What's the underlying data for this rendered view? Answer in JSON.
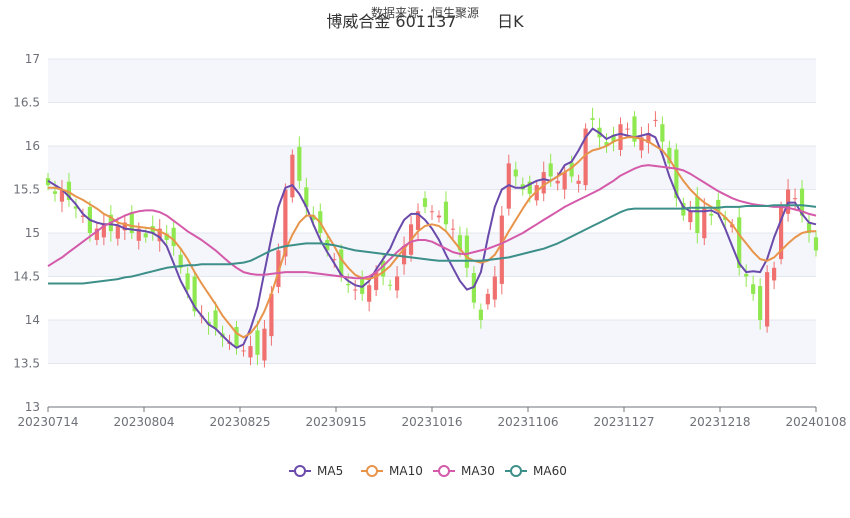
{
  "chart_data": {
    "type": "candlestick",
    "title": "博威合金 601137        日K",
    "subtitle": "数据来源：恒生聚源",
    "ylim": [
      13,
      17
    ],
    "y_ticks": [
      13,
      13.5,
      14,
      14.5,
      15,
      15.5,
      16,
      16.5,
      17
    ],
    "x_tick_labels": [
      "20230714",
      "20230804",
      "20230825",
      "20230915",
      "20231016",
      "20231106",
      "20231127",
      "20231218",
      "20240108"
    ],
    "grid": true,
    "legend_position": "bottom-center",
    "up_color": "#f07070",
    "down_color": "#90e850",
    "close": [
      15.55,
      15.45,
      15.5,
      15.38,
      15.28,
      15.2,
      15.0,
      15.05,
      15.1,
      15.02,
      15.08,
      15.12,
      15.0,
      15.05,
      14.95,
      15.0,
      15.05,
      14.92,
      14.85,
      14.6,
      14.35,
      14.1,
      14.05,
      13.95,
      13.9,
      13.8,
      13.75,
      13.7,
      13.65,
      13.7,
      13.6,
      13.9,
      14.3,
      14.8,
      15.5,
      15.9,
      15.6,
      15.3,
      15.15,
      15.0,
      14.8,
      14.7,
      14.5,
      14.4,
      14.35,
      14.3,
      14.4,
      14.55,
      14.5,
      14.4,
      14.5,
      14.85,
      15.1,
      15.25,
      15.3,
      15.25,
      15.2,
      15.1,
      15.05,
      14.8,
      14.6,
      14.2,
      14.0,
      14.3,
      14.5,
      15.2,
      15.8,
      15.65,
      15.5,
      15.45,
      15.55,
      15.7,
      15.65,
      15.6,
      15.7,
      15.65,
      15.6,
      16.2,
      16.3,
      16.1,
      16.0,
      16.05,
      16.25,
      16.2,
      16.05,
      16.1,
      16.15,
      16.3,
      16.05,
      15.8,
      15.4,
      15.2,
      15.25,
      15.0,
      15.3,
      15.2,
      15.25,
      15.15,
      15.1,
      14.6,
      14.5,
      14.3,
      14.0,
      14.55,
      14.6,
      15.3,
      15.5,
      15.4,
      15.2,
      15.0,
      14.8
    ],
    "series": [
      {
        "name": "MA5",
        "color": "#6a4aab",
        "values": [
          15.6,
          15.55,
          15.5,
          15.42,
          15.33,
          15.22,
          15.15,
          15.12,
          15.1,
          15.1,
          15.09,
          15.05,
          15.04,
          15.03,
          15.02,
          15.0,
          14.95,
          14.85,
          14.65,
          14.45,
          14.3,
          14.15,
          14.05,
          13.95,
          13.9,
          13.82,
          13.74,
          13.68,
          13.72,
          13.9,
          14.15,
          14.55,
          14.95,
          15.3,
          15.52,
          15.55,
          15.45,
          15.3,
          15.1,
          14.92,
          14.78,
          14.65,
          14.52,
          14.45,
          14.4,
          14.38,
          14.45,
          14.58,
          14.7,
          14.82,
          15.0,
          15.15,
          15.22,
          15.22,
          15.15,
          15.05,
          14.92,
          14.75,
          14.6,
          14.45,
          14.35,
          14.38,
          14.55,
          14.95,
          15.3,
          15.5,
          15.55,
          15.52,
          15.52,
          15.56,
          15.6,
          15.62,
          15.6,
          15.65,
          15.78,
          15.82,
          15.95,
          16.1,
          16.2,
          16.15,
          16.08,
          16.12,
          16.14,
          16.12,
          16.1,
          16.12,
          16.14,
          16.1,
          15.9,
          15.65,
          15.45,
          15.3,
          15.25,
          15.25,
          15.25,
          15.26,
          15.22,
          15.05,
          14.85,
          14.65,
          14.55,
          14.56,
          14.55,
          14.7,
          14.95,
          15.15,
          15.35,
          15.35,
          15.22,
          15.12,
          15.1
        ]
      },
      {
        "name": "MA10",
        "color": "#e8944a",
        "values": [
          15.52,
          15.52,
          15.5,
          15.47,
          15.42,
          15.38,
          15.33,
          15.28,
          15.22,
          15.18,
          15.12,
          15.1,
          15.08,
          15.07,
          15.06,
          15.05,
          15.02,
          14.98,
          14.92,
          14.82,
          14.7,
          14.55,
          14.42,
          14.3,
          14.18,
          14.05,
          13.95,
          13.85,
          13.8,
          13.85,
          13.95,
          14.1,
          14.3,
          14.55,
          14.8,
          14.98,
          15.12,
          15.2,
          15.2,
          15.12,
          14.98,
          14.85,
          14.7,
          14.6,
          14.52,
          14.48,
          14.47,
          14.5,
          14.55,
          14.62,
          14.72,
          14.82,
          14.92,
          15.02,
          15.08,
          15.1,
          15.08,
          15.02,
          14.92,
          14.82,
          14.72,
          14.68,
          14.66,
          14.68,
          14.75,
          14.88,
          15.02,
          15.15,
          15.28,
          15.4,
          15.48,
          15.55,
          15.6,
          15.65,
          15.7,
          15.75,
          15.82,
          15.9,
          15.95,
          15.97,
          16.0,
          16.05,
          16.08,
          16.1,
          16.1,
          16.08,
          16.05,
          16.0,
          15.95,
          15.85,
          15.72,
          15.6,
          15.5,
          15.42,
          15.35,
          15.3,
          15.25,
          15.18,
          15.1,
          14.98,
          14.88,
          14.78,
          14.7,
          14.68,
          14.72,
          14.8,
          14.88,
          14.95,
          15.0,
          15.02,
          15.02
        ]
      },
      {
        "name": "MA30",
        "color": "#d45aaa",
        "values": [
          14.62,
          14.67,
          14.72,
          14.78,
          14.84,
          14.9,
          14.96,
          15.02,
          15.08,
          15.12,
          15.16,
          15.2,
          15.23,
          15.25,
          15.26,
          15.26,
          15.24,
          15.2,
          15.14,
          15.08,
          15.02,
          14.97,
          14.92,
          14.86,
          14.8,
          14.73,
          14.66,
          14.6,
          14.55,
          14.53,
          14.52,
          14.52,
          14.53,
          14.54,
          14.55,
          14.55,
          14.55,
          14.55,
          14.54,
          14.53,
          14.52,
          14.51,
          14.5,
          14.49,
          14.48,
          14.48,
          14.5,
          14.55,
          14.62,
          14.7,
          14.78,
          14.85,
          14.9,
          14.92,
          14.92,
          14.9,
          14.86,
          14.82,
          14.78,
          14.76,
          14.76,
          14.78,
          14.8,
          14.82,
          14.85,
          14.88,
          14.92,
          14.96,
          15.0,
          15.05,
          15.1,
          15.15,
          15.2,
          15.25,
          15.3,
          15.34,
          15.38,
          15.42,
          15.46,
          15.5,
          15.55,
          15.6,
          15.66,
          15.7,
          15.74,
          15.77,
          15.78,
          15.77,
          15.76,
          15.75,
          15.74,
          15.72,
          15.68,
          15.63,
          15.58,
          15.53,
          15.48,
          15.44,
          15.4,
          15.37,
          15.35,
          15.33,
          15.32,
          15.31,
          15.3,
          15.3,
          15.29,
          15.27,
          15.25,
          15.22,
          15.2
        ]
      },
      {
        "name": "MA60",
        "color": "#3d8f8a",
        "values": [
          14.42,
          14.42,
          14.42,
          14.42,
          14.42,
          14.42,
          14.43,
          14.44,
          14.45,
          14.46,
          14.47,
          14.49,
          14.5,
          14.52,
          14.54,
          14.56,
          14.58,
          14.6,
          14.61,
          14.62,
          14.63,
          14.63,
          14.64,
          14.64,
          14.64,
          14.64,
          14.64,
          14.65,
          14.66,
          14.68,
          14.72,
          14.76,
          14.8,
          14.83,
          14.85,
          14.86,
          14.87,
          14.88,
          14.88,
          14.88,
          14.87,
          14.86,
          14.84,
          14.82,
          14.8,
          14.79,
          14.78,
          14.77,
          14.76,
          14.75,
          14.74,
          14.73,
          14.72,
          14.71,
          14.7,
          14.69,
          14.68,
          14.68,
          14.68,
          14.68,
          14.68,
          14.68,
          14.68,
          14.69,
          14.7,
          14.71,
          14.72,
          14.74,
          14.76,
          14.78,
          14.8,
          14.82,
          14.85,
          14.88,
          14.92,
          14.96,
          15.0,
          15.04,
          15.08,
          15.12,
          15.16,
          15.2,
          15.24,
          15.27,
          15.28,
          15.28,
          15.28,
          15.28,
          15.28,
          15.28,
          15.28,
          15.28,
          15.29,
          15.29,
          15.29,
          15.29,
          15.29,
          15.3,
          15.3,
          15.3,
          15.31,
          15.31,
          15.31,
          15.31,
          15.32,
          15.32,
          15.32,
          15.32,
          15.32,
          15.31,
          15.3
        ]
      }
    ]
  }
}
